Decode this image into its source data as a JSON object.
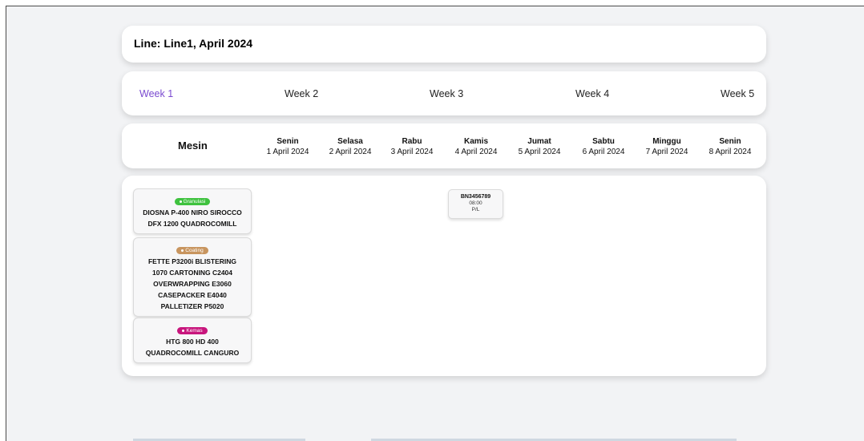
{
  "header": {
    "title": "Line: Line1, April 2024"
  },
  "weeks": [
    "Week 1",
    "Week 2",
    "Week 3",
    "Week 4",
    "Week 5"
  ],
  "active_week": "Week 1",
  "table_header": {
    "machine_label": "Mesin",
    "days": [
      {
        "name": "Senin",
        "date": "1 April 2024"
      },
      {
        "name": "Selasa",
        "date": "2 April 2024"
      },
      {
        "name": "Rabu",
        "date": "3 April 2024"
      },
      {
        "name": "Kamis",
        "date": "4 April 2024"
      },
      {
        "name": "Jumat",
        "date": "5 April 2024"
      },
      {
        "name": "Sabtu",
        "date": "6 April 2024"
      },
      {
        "name": "Minggu",
        "date": "7 April 2024"
      },
      {
        "name": "Senin",
        "date": "8 April 2024"
      }
    ]
  },
  "machines": [
    {
      "category": "Granulasi",
      "color": "#3fc23f",
      "lines": [
        "DIOSNA P-400 NIRO SIROCCO",
        "DFX 1200 QUADROCOMILL"
      ]
    },
    {
      "category": "Coating",
      "color": "#c8955f",
      "lines": [
        "FETTE P3200i BLISTERING",
        "1070 CARTONING C2404",
        "OVERWRAPPING E3060",
        "CASEPACKER E4040",
        "PALLETIZER P5020"
      ]
    },
    {
      "category": "Kemas",
      "color": "#c8167d",
      "lines": [
        "HTG 800 HD 400",
        "QUADROCOMILL CANGURO"
      ]
    }
  ],
  "event": {
    "code": "BN3456789",
    "time": "08:00",
    "type": "P/L"
  },
  "colors": {
    "active_week": "#7b4bd0",
    "background": "#f2f3f5"
  }
}
